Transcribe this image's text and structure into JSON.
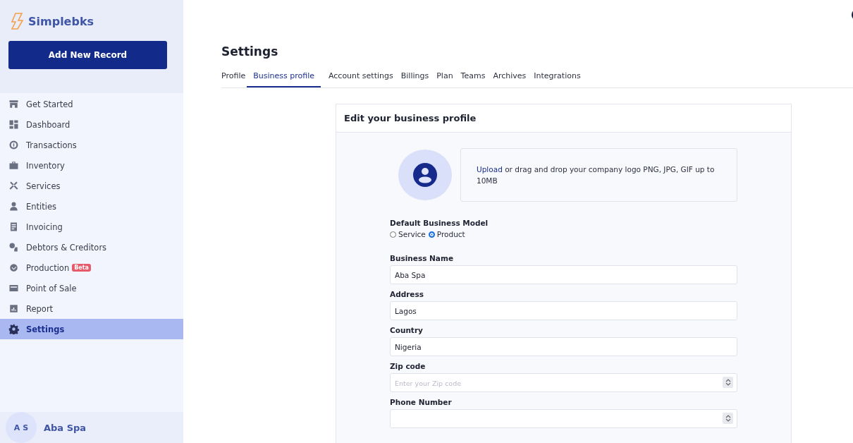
{
  "sidebar": {
    "brand": "Simplebks",
    "add_button": "Add New Record",
    "items": [
      {
        "label": "Get Started",
        "selected": false
      },
      {
        "label": "Dashboard",
        "selected": false
      },
      {
        "label": "Transactions",
        "selected": false
      },
      {
        "label": "Inventory",
        "selected": false
      },
      {
        "label": "Services",
        "selected": false
      },
      {
        "label": "Entities",
        "selected": false
      },
      {
        "label": "Invoicing",
        "selected": false
      },
      {
        "label": "Debtors & Creditors",
        "selected": false
      },
      {
        "label": "Production",
        "badge": "Beta",
        "selected": false
      },
      {
        "label": "Point of Sale",
        "selected": false
      },
      {
        "label": "Report",
        "selected": false
      },
      {
        "label": "Settings",
        "selected": true
      }
    ],
    "user": {
      "initials": "A S",
      "name": "Aba Spa"
    }
  },
  "page": {
    "title": "Settings",
    "tabs": [
      {
        "label": "Profile",
        "selected": false
      },
      {
        "label": "Business profile",
        "selected": true
      },
      {
        "label": "Account settings",
        "selected": false
      },
      {
        "label": "Billings",
        "selected": false
      },
      {
        "label": "Plan",
        "selected": false
      },
      {
        "label": "Teams",
        "selected": false
      },
      {
        "label": "Archives",
        "selected": false
      },
      {
        "label": "Integrations",
        "selected": false
      }
    ]
  },
  "card": {
    "title": "Edit your business profile",
    "upload": {
      "link": "Upload",
      "text": "or drag and drop your company logo PNG, JPG, GIF up to 10MB"
    },
    "model": {
      "label": "Default Business Model",
      "options": [
        {
          "label": "Service",
          "selected": false
        },
        {
          "label": "Product",
          "selected": true
        }
      ]
    },
    "fields": [
      {
        "label": "Business Name",
        "value": "Aba Spa",
        "kind": "text"
      },
      {
        "label": "Address",
        "value": "Lagos",
        "kind": "text"
      },
      {
        "label": "Country",
        "value": "Nigeria",
        "kind": "text"
      },
      {
        "label": "Zip code",
        "placeholder": "Enter your Zip code",
        "kind": "number"
      },
      {
        "label": "Phone Number",
        "kind": "number"
      }
    ]
  }
}
